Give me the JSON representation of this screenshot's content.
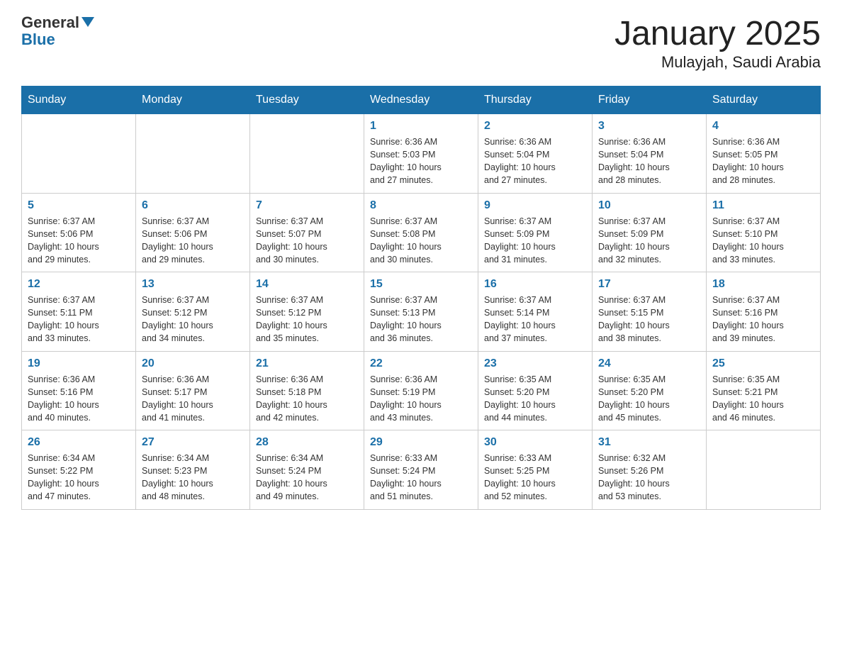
{
  "header": {
    "logo_general": "General",
    "logo_blue": "Blue",
    "title": "January 2025",
    "subtitle": "Mulayjah, Saudi Arabia"
  },
  "days_of_week": [
    "Sunday",
    "Monday",
    "Tuesday",
    "Wednesday",
    "Thursday",
    "Friday",
    "Saturday"
  ],
  "weeks": [
    [
      {
        "day": "",
        "info": ""
      },
      {
        "day": "",
        "info": ""
      },
      {
        "day": "",
        "info": ""
      },
      {
        "day": "1",
        "info": "Sunrise: 6:36 AM\nSunset: 5:03 PM\nDaylight: 10 hours\nand 27 minutes."
      },
      {
        "day": "2",
        "info": "Sunrise: 6:36 AM\nSunset: 5:04 PM\nDaylight: 10 hours\nand 27 minutes."
      },
      {
        "day": "3",
        "info": "Sunrise: 6:36 AM\nSunset: 5:04 PM\nDaylight: 10 hours\nand 28 minutes."
      },
      {
        "day": "4",
        "info": "Sunrise: 6:36 AM\nSunset: 5:05 PM\nDaylight: 10 hours\nand 28 minutes."
      }
    ],
    [
      {
        "day": "5",
        "info": "Sunrise: 6:37 AM\nSunset: 5:06 PM\nDaylight: 10 hours\nand 29 minutes."
      },
      {
        "day": "6",
        "info": "Sunrise: 6:37 AM\nSunset: 5:06 PM\nDaylight: 10 hours\nand 29 minutes."
      },
      {
        "day": "7",
        "info": "Sunrise: 6:37 AM\nSunset: 5:07 PM\nDaylight: 10 hours\nand 30 minutes."
      },
      {
        "day": "8",
        "info": "Sunrise: 6:37 AM\nSunset: 5:08 PM\nDaylight: 10 hours\nand 30 minutes."
      },
      {
        "day": "9",
        "info": "Sunrise: 6:37 AM\nSunset: 5:09 PM\nDaylight: 10 hours\nand 31 minutes."
      },
      {
        "day": "10",
        "info": "Sunrise: 6:37 AM\nSunset: 5:09 PM\nDaylight: 10 hours\nand 32 minutes."
      },
      {
        "day": "11",
        "info": "Sunrise: 6:37 AM\nSunset: 5:10 PM\nDaylight: 10 hours\nand 33 minutes."
      }
    ],
    [
      {
        "day": "12",
        "info": "Sunrise: 6:37 AM\nSunset: 5:11 PM\nDaylight: 10 hours\nand 33 minutes."
      },
      {
        "day": "13",
        "info": "Sunrise: 6:37 AM\nSunset: 5:12 PM\nDaylight: 10 hours\nand 34 minutes."
      },
      {
        "day": "14",
        "info": "Sunrise: 6:37 AM\nSunset: 5:12 PM\nDaylight: 10 hours\nand 35 minutes."
      },
      {
        "day": "15",
        "info": "Sunrise: 6:37 AM\nSunset: 5:13 PM\nDaylight: 10 hours\nand 36 minutes."
      },
      {
        "day": "16",
        "info": "Sunrise: 6:37 AM\nSunset: 5:14 PM\nDaylight: 10 hours\nand 37 minutes."
      },
      {
        "day": "17",
        "info": "Sunrise: 6:37 AM\nSunset: 5:15 PM\nDaylight: 10 hours\nand 38 minutes."
      },
      {
        "day": "18",
        "info": "Sunrise: 6:37 AM\nSunset: 5:16 PM\nDaylight: 10 hours\nand 39 minutes."
      }
    ],
    [
      {
        "day": "19",
        "info": "Sunrise: 6:36 AM\nSunset: 5:16 PM\nDaylight: 10 hours\nand 40 minutes."
      },
      {
        "day": "20",
        "info": "Sunrise: 6:36 AM\nSunset: 5:17 PM\nDaylight: 10 hours\nand 41 minutes."
      },
      {
        "day": "21",
        "info": "Sunrise: 6:36 AM\nSunset: 5:18 PM\nDaylight: 10 hours\nand 42 minutes."
      },
      {
        "day": "22",
        "info": "Sunrise: 6:36 AM\nSunset: 5:19 PM\nDaylight: 10 hours\nand 43 minutes."
      },
      {
        "day": "23",
        "info": "Sunrise: 6:35 AM\nSunset: 5:20 PM\nDaylight: 10 hours\nand 44 minutes."
      },
      {
        "day": "24",
        "info": "Sunrise: 6:35 AM\nSunset: 5:20 PM\nDaylight: 10 hours\nand 45 minutes."
      },
      {
        "day": "25",
        "info": "Sunrise: 6:35 AM\nSunset: 5:21 PM\nDaylight: 10 hours\nand 46 minutes."
      }
    ],
    [
      {
        "day": "26",
        "info": "Sunrise: 6:34 AM\nSunset: 5:22 PM\nDaylight: 10 hours\nand 47 minutes."
      },
      {
        "day": "27",
        "info": "Sunrise: 6:34 AM\nSunset: 5:23 PM\nDaylight: 10 hours\nand 48 minutes."
      },
      {
        "day": "28",
        "info": "Sunrise: 6:34 AM\nSunset: 5:24 PM\nDaylight: 10 hours\nand 49 minutes."
      },
      {
        "day": "29",
        "info": "Sunrise: 6:33 AM\nSunset: 5:24 PM\nDaylight: 10 hours\nand 51 minutes."
      },
      {
        "day": "30",
        "info": "Sunrise: 6:33 AM\nSunset: 5:25 PM\nDaylight: 10 hours\nand 52 minutes."
      },
      {
        "day": "31",
        "info": "Sunrise: 6:32 AM\nSunset: 5:26 PM\nDaylight: 10 hours\nand 53 minutes."
      },
      {
        "day": "",
        "info": ""
      }
    ]
  ]
}
